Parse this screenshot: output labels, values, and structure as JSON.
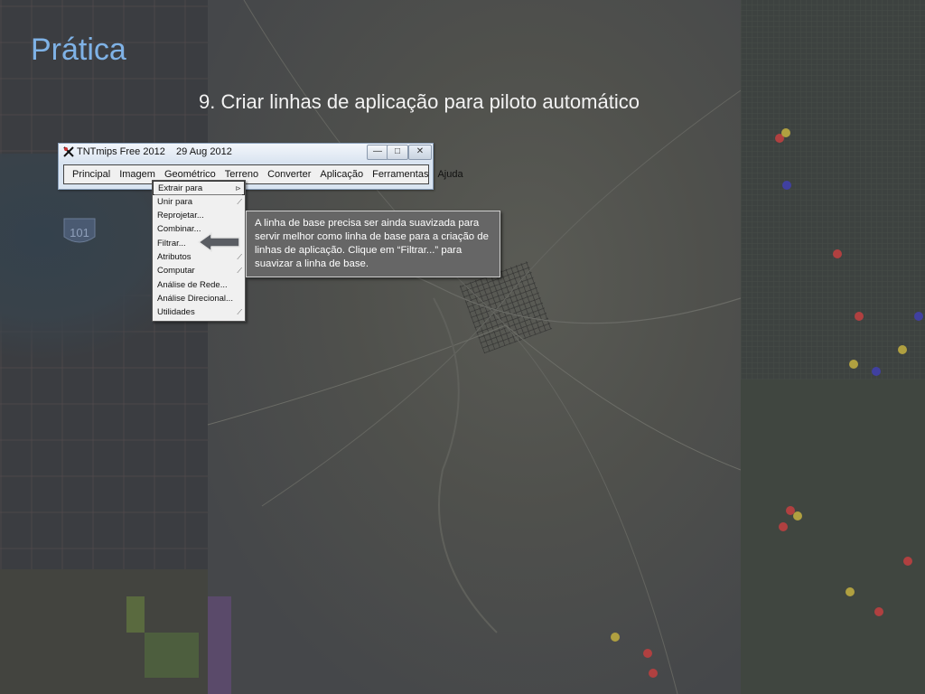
{
  "slide": {
    "title": "Prática",
    "subtitle": "9. Criar linhas de aplicação para piloto automático"
  },
  "window": {
    "title": "TNTmips Free 2012    29 Aug 2012",
    "buttons": {
      "minimize": "—",
      "maximize": "□",
      "close": "✕"
    },
    "menu": [
      "Principal",
      "Imagem",
      "Geométrico",
      "Terreno",
      "Converter",
      "Aplicação",
      "Ferramentas",
      "Ajuda"
    ]
  },
  "dropdown": {
    "items": [
      {
        "label": "Extrair para",
        "submenu": true
      },
      {
        "label": "Unir para",
        "submenu": true
      },
      {
        "label": "Reprojetar...",
        "submenu": false
      },
      {
        "label": "Combinar...",
        "submenu": false
      },
      {
        "label": "Filtrar...",
        "submenu": false
      },
      {
        "label": "Atributos",
        "submenu": true
      },
      {
        "label": "Computar",
        "submenu": true
      },
      {
        "label": "Análise de Rede...",
        "submenu": false
      },
      {
        "label": "Análise Direcional...",
        "submenu": false
      },
      {
        "label": "Utilidades",
        "submenu": true
      }
    ]
  },
  "callout": {
    "text": "A linha de base precisa ser ainda suavizada para servir melhor como linha de base para a criação de linhas de aplicação. Clique em “Filtrar...” para suavizar a linha de base."
  },
  "background": {
    "highway_shield": "101"
  },
  "colors": {
    "title": "#7fb2e6",
    "callout_bg": "#666666",
    "menubar_bg": "#f0f0f0",
    "window_frame": "#d9e4f1"
  }
}
